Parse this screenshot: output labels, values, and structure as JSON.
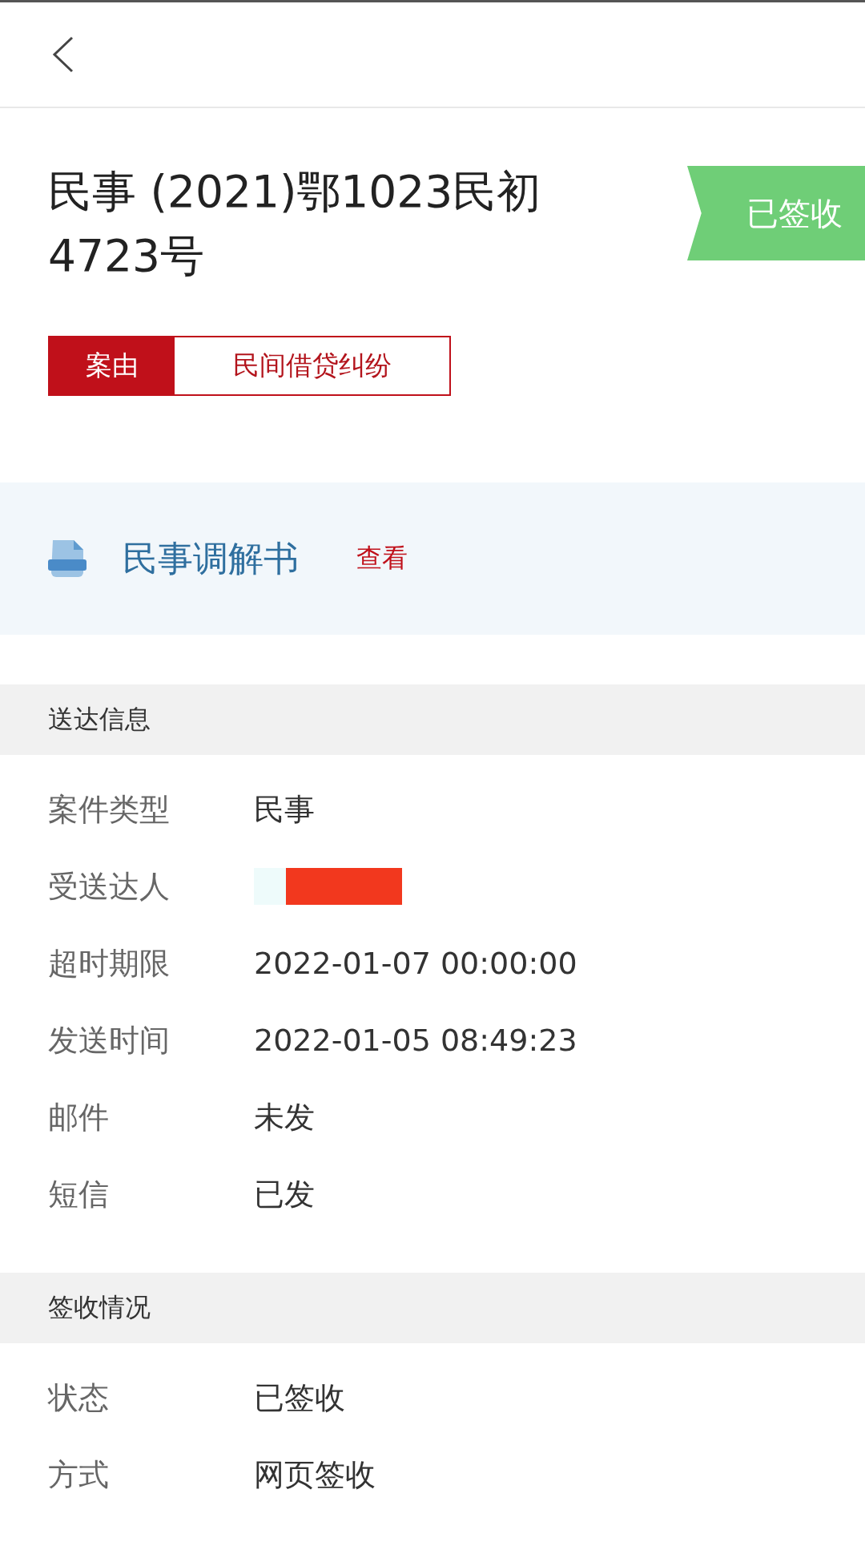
{
  "case": {
    "title": "民事 (2021)鄂1023民初4723号",
    "status": "已签收",
    "cause_label": "案由",
    "cause": "民间借贷纠纷"
  },
  "document": {
    "name": "民事调解书",
    "action": "查看"
  },
  "sections": [
    {
      "title": "送达信息",
      "rows": [
        {
          "label": "案件类型",
          "value": "民事"
        },
        {
          "label": "受送达人",
          "redacted": true
        },
        {
          "label": "超时期限",
          "value": "2022-01-07 00:00:00"
        },
        {
          "label": "发送时间",
          "value": "2022-01-05 08:49:23"
        },
        {
          "label": "邮件",
          "value": "未发"
        },
        {
          "label": "短信",
          "value": "已发"
        }
      ]
    },
    {
      "title": "签收情况",
      "rows": [
        {
          "label": "状态",
          "value": "已签收"
        },
        {
          "label": "方式",
          "value": "网页签收"
        }
      ]
    }
  ]
}
